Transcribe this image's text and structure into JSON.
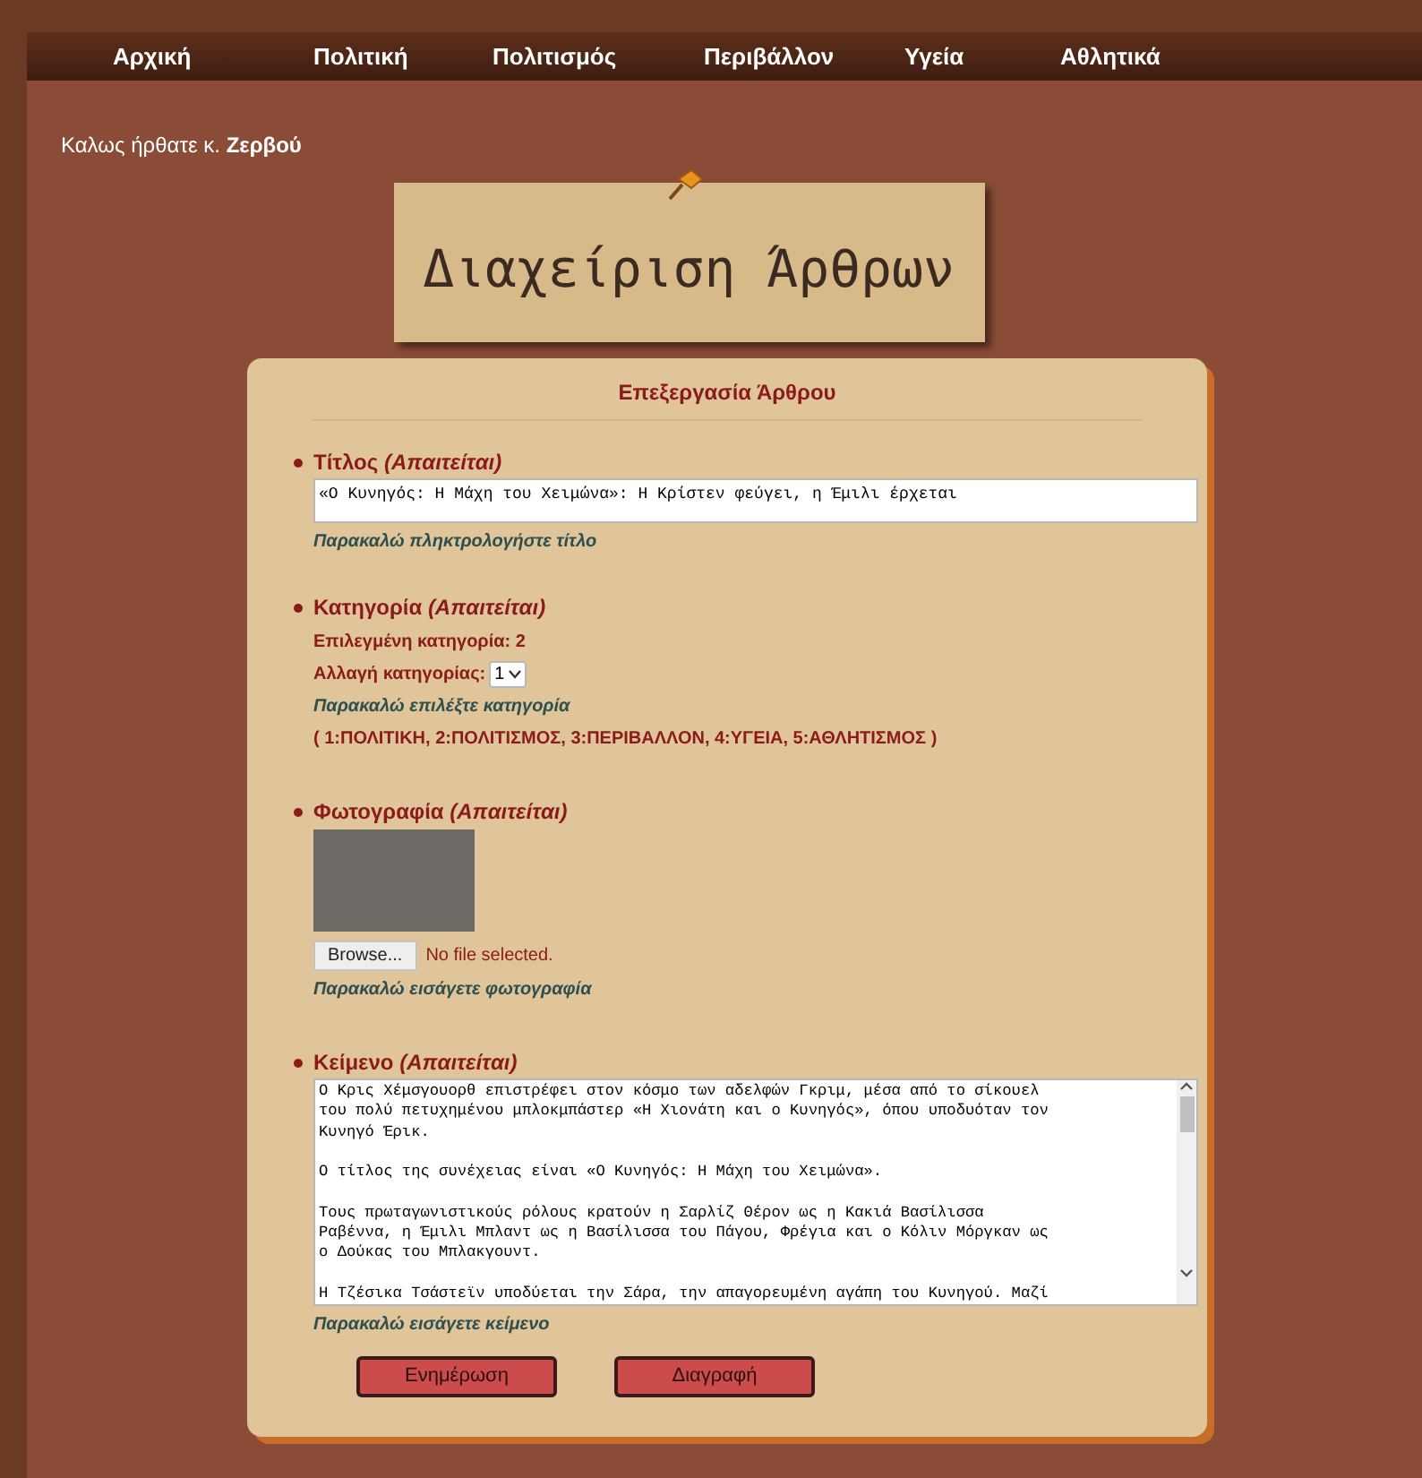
{
  "nav": [
    {
      "label": "Αρχική"
    },
    {
      "label": "Πολιτική"
    },
    {
      "label": "Πολιτισμός"
    },
    {
      "label": "Περιβάλλον"
    },
    {
      "label": "Υγεία"
    },
    {
      "label": "Αθλητικά"
    }
  ],
  "welcome": {
    "text": "Καλως ήρθατε κ.",
    "name": "Ζερβού"
  },
  "page_title": "Διαχείριση Άρθρων",
  "form": {
    "heading": "Επεξεργασία Άρθρου",
    "sections": [
      {
        "kind": "title",
        "label": "Τίτλος",
        "required": "(Απαιτείται)",
        "value": "«Ο Κυνηγός: Η Μάχη του Χειμώνα»: Η Κρίστεν φεύγει, η Έμιλι έρχεται",
        "hint": "Παρακαλώ πληκτρολογήστε τίτλο"
      },
      {
        "kind": "category",
        "label": "Κατηγορία",
        "required": "(Απαιτείται)",
        "current": "Επιλεγμένη κατηγορία: 2",
        "change_label": "Αλλαγή κατηγορίας:",
        "select_value": "1",
        "hint": "Παρακαλώ επιλέξτε κατηγορία",
        "legend": "( 1:ΠΟΛΙΤΙΚΗ, 2:ΠΟΛΙΤΙΣΜΟΣ, 3:ΠΕΡΙΒΑΛΛΟΝ, 4:ΥΓΕΙΑ, 5:ΑΘΛΗΤΙΣΜΟΣ )"
      },
      {
        "kind": "photo",
        "label": "Φωτογραφία",
        "required": "(Απαιτείται)",
        "browse": "Browse...",
        "file_status": "No file selected.",
        "hint": "Παρακαλώ εισάγετε φωτογραφία"
      },
      {
        "kind": "body",
        "label": "Κείμενο",
        "required": "(Απαιτείται)",
        "paragraphs": [
          [
            "Ο Κρις Χέμσγουορθ επιστρέφει στον κόσμο των αδελφών Γκριμ, μέσα από το σίκουελ",
            "του πολύ πετυχημένου μπλοκμπάστερ «Η Χιονάτη και ο Κυνηγός», όπου υποδυόταν τον",
            "Κυνηγό Έρικ."
          ],
          [
            "Ο τίτλος της συνέχειας είναι «Ο Κυνηγός: Η Μάχη του Χειμώνα»."
          ],
          [
            "Τους πρωταγωνιστικούς ρόλους κρατούν η Σαρλίζ Θέρον ως η Κακιά Βασίλισσα",
            "Ραβέννα, η Έμιλι Μπλαντ ως η Βασίλισσα του Πάγου, Φρέγια και ο Κόλιν Μόργκαν ως",
            "ο Δούκας του Μπλακγουντ."
          ],
          [
            "Η Τζέσικα Τσάστεϊν υποδύεται την Σάρα, την απαγορευμένη αγάπη του Κυνηγού. Μαζί"
          ]
        ],
        "hint": "Παρακαλώ εισάγετε κείμενο"
      }
    ],
    "buttons": [
      {
        "label": "Ενημέρωση"
      },
      {
        "label": "Διαγραφή"
      }
    ]
  }
}
